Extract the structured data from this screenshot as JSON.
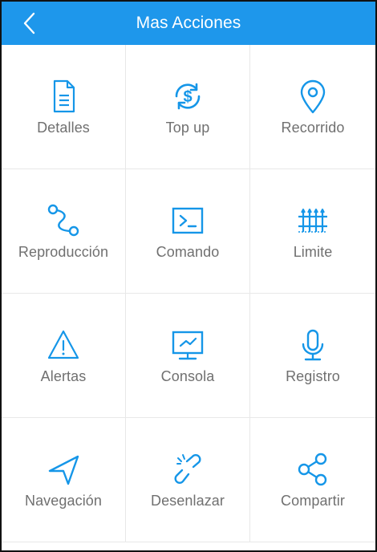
{
  "header": {
    "title": "Mas Acciones"
  },
  "actions": [
    {
      "label": "Detalles",
      "icon": "document-icon"
    },
    {
      "label": "Top up",
      "icon": "dollar-refresh-icon"
    },
    {
      "label": "Recorrido",
      "icon": "location-pin-icon"
    },
    {
      "label": "Reproducción",
      "icon": "route-path-icon"
    },
    {
      "label": "Comando",
      "icon": "terminal-icon"
    },
    {
      "label": "Limite",
      "icon": "fence-icon"
    },
    {
      "label": "Alertas",
      "icon": "warning-icon"
    },
    {
      "label": "Consola",
      "icon": "monitor-chart-icon"
    },
    {
      "label": "Registro",
      "icon": "microphone-icon"
    },
    {
      "label": "Navegación",
      "icon": "navigation-arrow-icon"
    },
    {
      "label": "Desenlazar",
      "icon": "broken-link-icon"
    },
    {
      "label": "Compartir",
      "icon": "share-icon"
    }
  ],
  "colors": {
    "header": "#1e97eb",
    "icon": "#1596e8",
    "label": "#707070",
    "divider": "#e8e8e8"
  }
}
